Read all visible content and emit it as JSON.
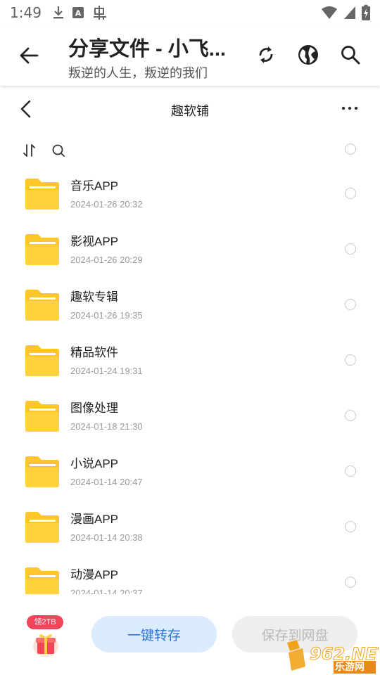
{
  "status_bar": {
    "time": "1:49",
    "icons": [
      "download-icon",
      "a-box-icon",
      "bug-icon",
      "wifi-icon",
      "signal-icon",
      "battery-icon"
    ]
  },
  "app_bar": {
    "title": "分享文件 - 小飞...",
    "subtitle": "叛逆的人生，叛逆的我们",
    "actions": [
      "refresh-icon",
      "globe-icon",
      "search-icon"
    ]
  },
  "folder_header": {
    "title": "趣软铺"
  },
  "files": [
    {
      "name": "音乐APP",
      "date": "2024-01-26 20:32"
    },
    {
      "name": "影视APP",
      "date": "2024-01-26 20:29"
    },
    {
      "name": "趣软专辑",
      "date": "2024-01-26 19:35"
    },
    {
      "name": "精品软件",
      "date": "2024-01-24 19:31"
    },
    {
      "name": "图像处理",
      "date": "2024-01-18 21:30"
    },
    {
      "name": "小说APP",
      "date": "2024-01-14 20:47"
    },
    {
      "name": "漫画APP",
      "date": "2024-01-14 20:38"
    },
    {
      "name": "动漫APP",
      "date": "2024-01-14 20:37"
    }
  ],
  "bottom_bar": {
    "gift_badge": "领2TB",
    "primary_button": "一键转存",
    "secondary_button": "保存到网盘"
  },
  "watermark": {
    "text": "962.NET",
    "sub": "乐游网"
  },
  "colors": {
    "folder": "#ffc62b",
    "primary_bg": "#d9ebfd",
    "primary_text": "#2f74d8",
    "badge": "#f2445b"
  }
}
